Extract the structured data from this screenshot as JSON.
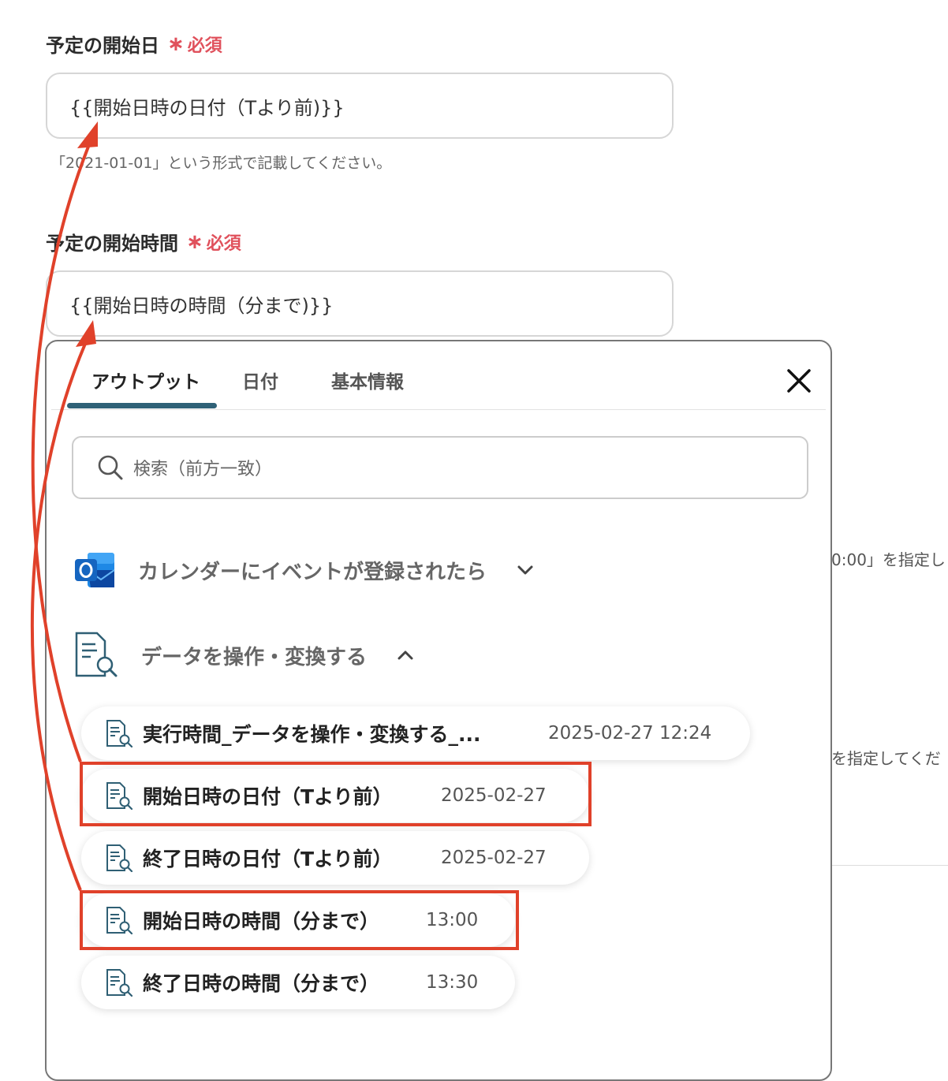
{
  "form": {
    "start_date": {
      "label": "予定の開始日",
      "required": "必須",
      "value": "{{開始日時の日付（Tより前)}}",
      "hint": "「2021-01-01」という形式で記載してください。"
    },
    "start_time": {
      "label": "予定の開始時間",
      "required": "必須",
      "value": "{{開始日時の時間（分まで)}}"
    }
  },
  "background": {
    "hint_fragment_1": "0:00」を指定し",
    "hint_fragment_2": "を指定してくだ"
  },
  "panel": {
    "tabs": [
      {
        "label": "アウトプット",
        "active": true
      },
      {
        "label": "日付",
        "active": false
      },
      {
        "label": "基本情報",
        "active": false
      }
    ],
    "search_placeholder": "検索（前方一致）",
    "groups": [
      {
        "label": "カレンダーにイベントが登録されたら",
        "icon": "outlook-icon",
        "expanded": false
      },
      {
        "label": "データを操作・変換する",
        "icon": "data-transform-icon",
        "expanded": true
      }
    ],
    "items": [
      {
        "name": "実行時間_データを操作・変換する_...",
        "value": "2025-02-27 12:24",
        "highlighted": false
      },
      {
        "name": "開始日時の日付（Tより前）",
        "value": "2025-02-27",
        "highlighted": true
      },
      {
        "name": "終了日時の日付（Tより前）",
        "value": "2025-02-27",
        "highlighted": false
      },
      {
        "name": "開始日時の時間（分まで）",
        "value": "13:00",
        "highlighted": true
      },
      {
        "name": "終了日時の時間（分まで）",
        "value": "13:30",
        "highlighted": false
      }
    ]
  },
  "colors": {
    "required": "#e0515c",
    "highlight": "#e0412a",
    "tab_indicator": "#2f6177"
  }
}
